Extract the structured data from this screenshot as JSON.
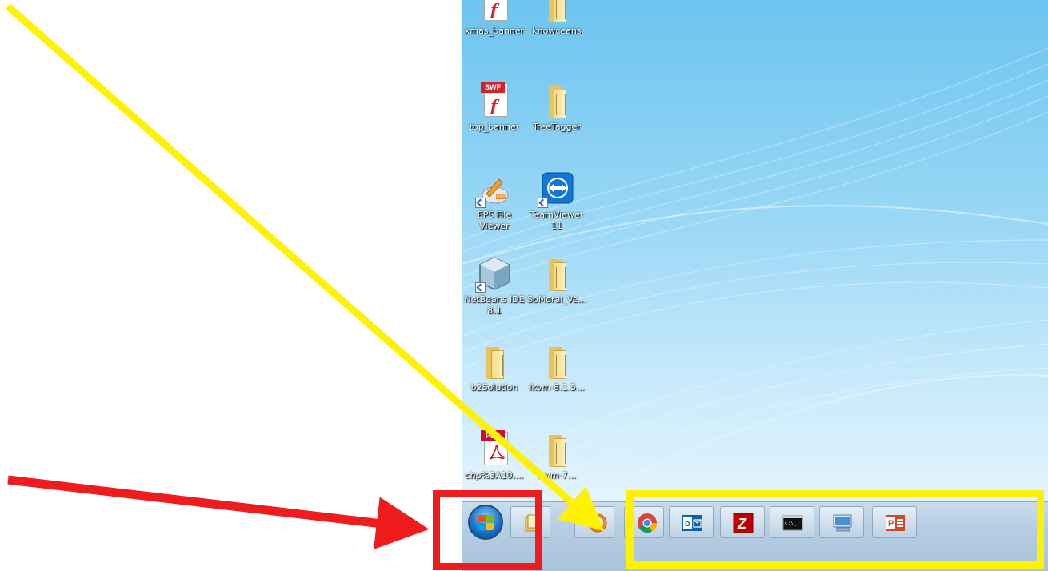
{
  "desktop": {
    "icons": [
      {
        "label": "xmas_banner",
        "type": "swf"
      },
      {
        "label": "knowceans",
        "type": "folder"
      },
      {
        "label": "top_banner",
        "type": "swf"
      },
      {
        "label": "TreeTagger",
        "type": "folder"
      },
      {
        "label": "EPS File Viewer",
        "type": "eps-app"
      },
      {
        "label": "TeamViewer 11",
        "type": "teamviewer"
      },
      {
        "label": "NetBeans IDE 8.1",
        "type": "netbeans"
      },
      {
        "label": "SoMoral_Ve...",
        "type": "folder"
      },
      {
        "label": "b2Solution",
        "type": "folder"
      },
      {
        "label": "ikvm-8.1.5...",
        "type": "folder"
      },
      {
        "label": "chp%3A10....",
        "type": "pdf"
      },
      {
        "label": "ikvm-7...",
        "type": "folder"
      }
    ],
    "file_tags": {
      "swf": "SWF",
      "pdf": "PDF",
      "eps": "EPS"
    }
  },
  "taskbar": {
    "start_button": "windows-start-orb",
    "pinned_apps": [
      {
        "name": "windows-explorer-icon"
      },
      {
        "name": "media-player-icon"
      },
      {
        "name": "chrome-icon"
      },
      {
        "name": "outlook-icon",
        "text": "o"
      },
      {
        "name": "filezilla-icon",
        "text": "Z"
      },
      {
        "name": "command-prompt-icon",
        "text": "C:\\_"
      },
      {
        "name": "remote-desktop-icon"
      },
      {
        "name": "powerpoint-icon",
        "text": "P"
      }
    ]
  },
  "annotations": {
    "red_color": "#ee1c1c",
    "yellow_color": "#fff200"
  }
}
